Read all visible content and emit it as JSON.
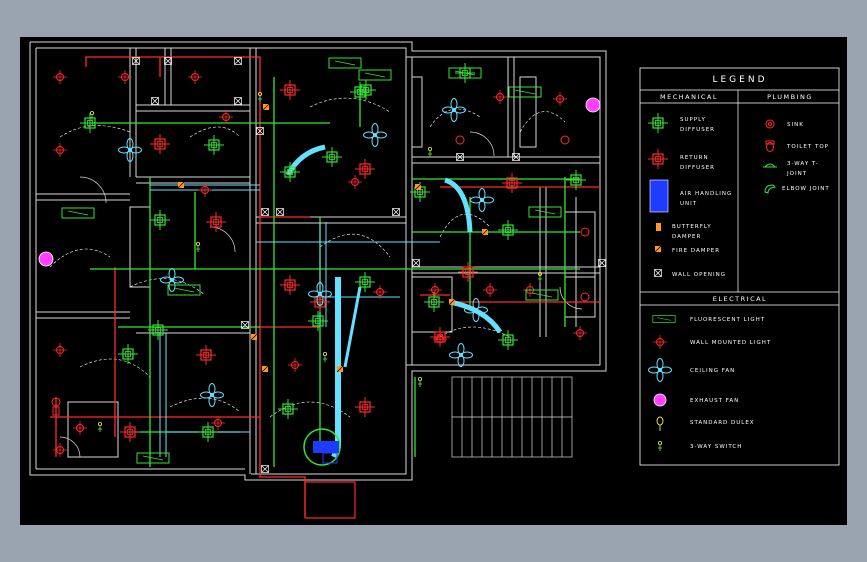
{
  "legend": {
    "title": "LEGEND",
    "sections": {
      "mechanical": "MECHANICAL",
      "plumbing": "PLUMBING",
      "electrical": "ELECTRICAL"
    },
    "mechanical_items": [
      {
        "line1": "SUPPLY",
        "line2": "DIFFUSER",
        "icon": "supply-diffuser-icon"
      },
      {
        "line1": "RETURN",
        "line2": "DIFFUSER",
        "icon": "return-diffuser-icon"
      },
      {
        "line1": "AIR HANDLING",
        "line2": "UNIT",
        "icon": "air-handling-unit-icon"
      },
      {
        "line1": "BUTTERFLY",
        "line2": "DAMPER",
        "icon": "butterfly-damper-icon"
      },
      {
        "line1": "FIRE DAMPER",
        "line2": "",
        "icon": "fire-damper-icon"
      },
      {
        "line1": "WALL OPENING",
        "line2": "",
        "icon": "wall-opening-icon"
      }
    ],
    "plumbing_items": [
      {
        "line1": "SINK",
        "line2": "",
        "icon": "sink-icon"
      },
      {
        "line1": "TOILET TOP",
        "line2": "",
        "icon": "toilet-top-icon"
      },
      {
        "line1": "3-WAY T-",
        "line2": "JOINT",
        "icon": "t-joint-icon"
      },
      {
        "line1": "ELBOW JOINT",
        "line2": "",
        "icon": "elbow-joint-icon"
      }
    ],
    "electrical_items": [
      {
        "line1": "FLUORESCENT LIGHT",
        "icon": "fluorescent-light-icon"
      },
      {
        "line1": "WALL MOUNTED LIGHT",
        "icon": "wall-light-icon"
      },
      {
        "line1": "CEILING FAN",
        "icon": "ceiling-fan-icon"
      },
      {
        "line1": "EXHAUST FAN",
        "icon": "exhaust-fan-icon"
      },
      {
        "line1": "STANDARD DULEX",
        "icon": "duplex-outlet-icon"
      },
      {
        "line1": "3-WAY SWITCH",
        "icon": "three-way-switch-icon"
      }
    ]
  },
  "colors": {
    "viewport_bg": "#000000",
    "frame_bg": "#9aa4b1",
    "wall": "#d9d9d9",
    "supply": "#33e633",
    "return": "#ff2a2a",
    "duct_cyan": "#66e0ff",
    "ahu_blue": "#1e3cff",
    "damper_orange": "#ff9a1a",
    "switch_yellow": "#ffe83a",
    "exhaust_magenta": "#ff40ff"
  }
}
